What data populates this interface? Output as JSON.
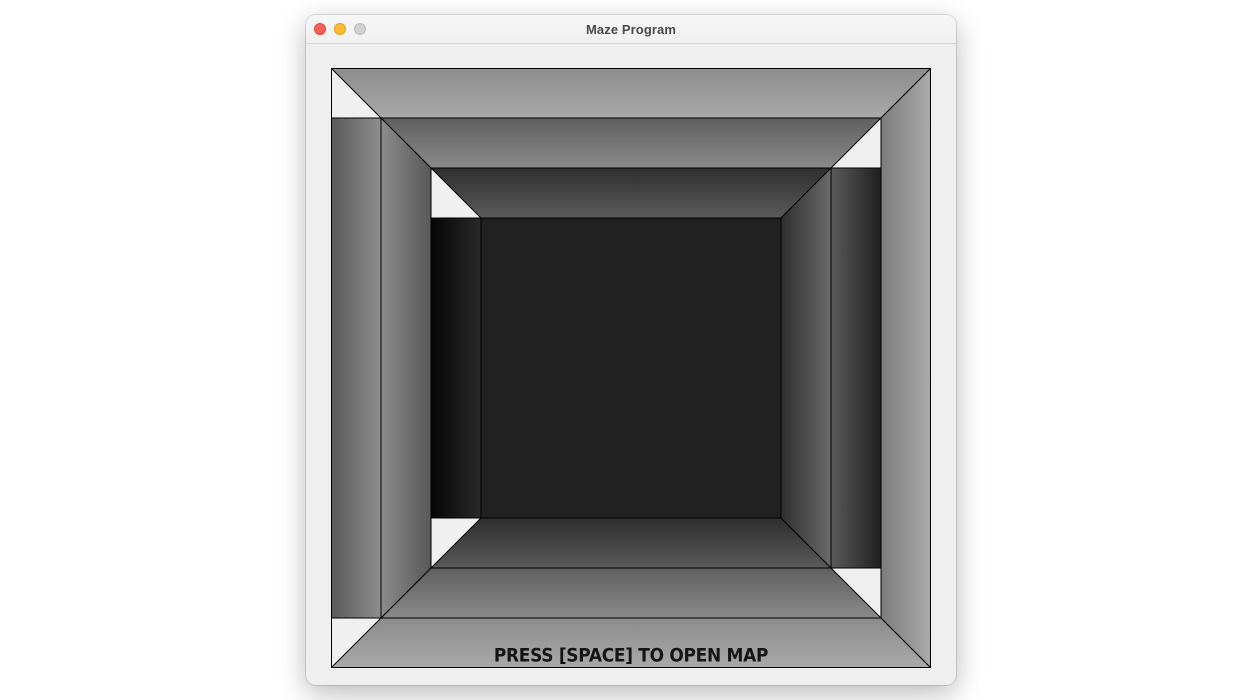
{
  "window": {
    "title": "Maze Program"
  },
  "titlebar_buttons": [
    {
      "role": "close",
      "color": "#fe5f57"
    },
    {
      "role": "minimize",
      "color": "#febc2e"
    },
    {
      "role": "zoom",
      "color": "#d1d1d1"
    }
  ],
  "maze_view": {
    "hint_text": "PRESS [SPACE] TO OPEN MAP",
    "wall_colors": {
      "outline": "#000000",
      "near": "#aaaaaa",
      "far": "#222222",
      "back_wall": "#212121"
    }
  }
}
